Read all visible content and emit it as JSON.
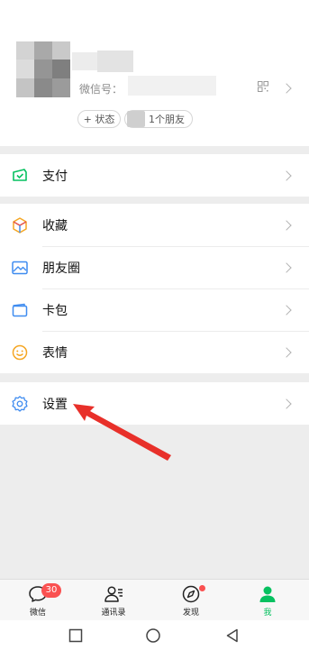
{
  "profile": {
    "wechat_id_label": "微信号：",
    "status_button": "+ 状态",
    "friends_count_label": "1个朋友"
  },
  "menu": {
    "pay": "支付",
    "favorites": "收藏",
    "moments": "朋友圈",
    "cards": "卡包",
    "stickers": "表情",
    "settings": "设置"
  },
  "tabs": {
    "chats": "微信",
    "chats_badge": "30",
    "contacts": "通讯录",
    "discover": "发现",
    "me": "我"
  },
  "colors": {
    "accent": "#07c160",
    "badge": "#fa5151",
    "annotation_arrow": "#e8302a"
  },
  "icons": [
    "pay-icon",
    "favorites-icon",
    "moments-icon",
    "cards-icon",
    "stickers-icon",
    "settings-icon",
    "qr-code-icon",
    "chats-icon",
    "contacts-icon",
    "discover-icon",
    "me-icon"
  ]
}
